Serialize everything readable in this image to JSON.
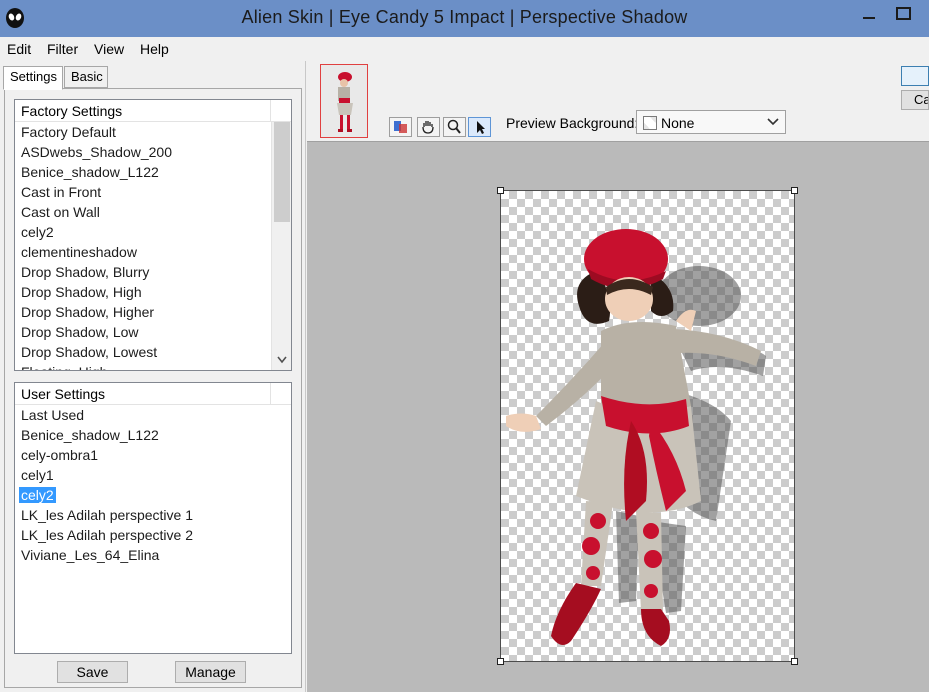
{
  "window": {
    "title": "Alien Skin | Eye Candy 5 Impact | Perspective Shadow"
  },
  "menu": {
    "items": [
      "Edit",
      "Filter",
      "View",
      "Help"
    ]
  },
  "tabs": {
    "settings": "Settings",
    "basic": "Basic"
  },
  "factory_settings": {
    "header": "Factory Settings",
    "items": [
      "Factory Default",
      "ASDwebs_Shadow_200",
      "Benice_shadow_L122",
      "Cast in Front",
      "Cast on Wall",
      "cely2",
      "clementineshadow",
      "Drop Shadow, Blurry",
      "Drop Shadow, High",
      "Drop Shadow, Higher",
      "Drop Shadow, Low",
      "Drop Shadow, Lowest",
      "Floating, High"
    ]
  },
  "user_settings": {
    "header": "User Settings",
    "items": [
      "Last Used",
      "Benice_shadow_L122",
      "cely-ombra1",
      "cely1",
      "cely2",
      "LK_les Adilah perspective 1",
      "LK_les Adilah perspective 2",
      "Viviane_Les_64_Elina"
    ],
    "selected": "cely2"
  },
  "buttons": {
    "save": "Save",
    "manage": "Manage",
    "cancel": "Ca"
  },
  "preview": {
    "label": "Preview Background:",
    "value": "None"
  },
  "colors": {
    "titlebar": "#6b8fc7",
    "selection": "#3399ff",
    "preview_bg": "#bababa"
  }
}
